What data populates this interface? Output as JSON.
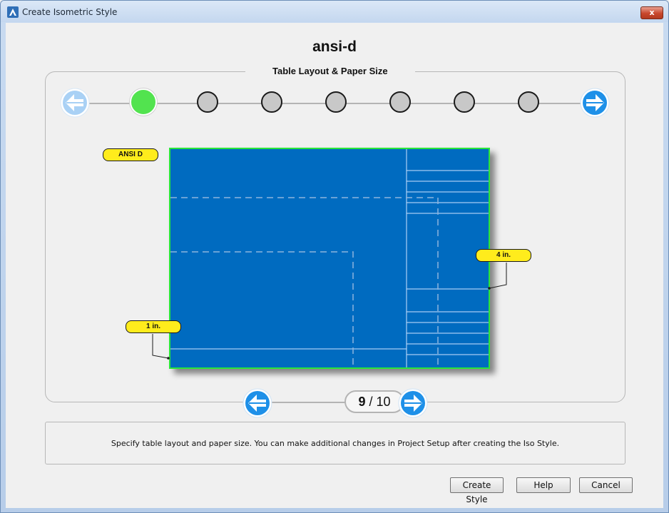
{
  "window": {
    "title": "Create Isometric Style",
    "close_label": "x"
  },
  "style_name": "ansi-d",
  "group_title": "Table Layout & Paper Size",
  "steps": {
    "total": 8,
    "active_index": 0
  },
  "preview": {
    "paper_label": "ANSI D",
    "table_width_label": "4 in.",
    "border_label": "1 in."
  },
  "pager": {
    "current": "9",
    "separator": "/",
    "total": "10"
  },
  "description": "Specify table layout and paper size.  You can make additional changes in Project Setup after creating the Iso Style.",
  "buttons": {
    "create": "Create Style",
    "help": "Help",
    "cancel": "Cancel"
  },
  "colors": {
    "active_step": "#52e34f",
    "paper": "#006bc0",
    "paper_border": "#29e63a",
    "badge": "#ffec1c",
    "arrow": "#1e90e8"
  }
}
